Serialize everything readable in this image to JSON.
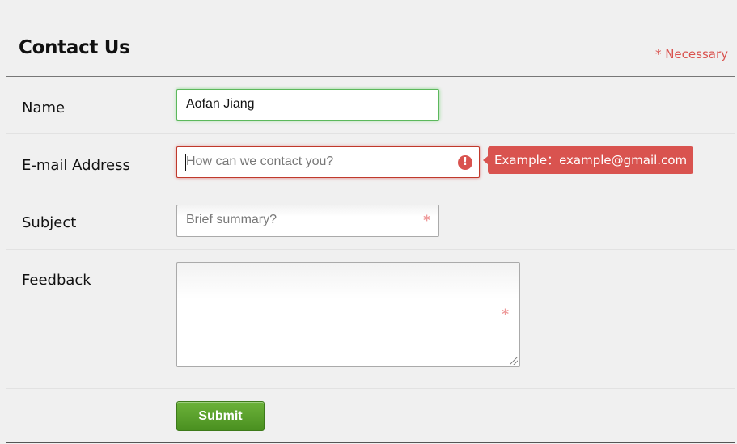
{
  "form": {
    "title": "Contact Us",
    "necessary_note": "* Necessary",
    "submit_label": "Submit"
  },
  "fields": {
    "name": {
      "label": "Name",
      "value": "Aofan Jiang"
    },
    "email": {
      "label": "E-mail Address",
      "placeholder": "How can we contact you?",
      "error_tooltip": "Example：example@gmail.com",
      "error_icon": "!"
    },
    "subject": {
      "label": "Subject",
      "placeholder": "Brief summary?"
    },
    "feedback": {
      "label": "Feedback",
      "value": ""
    }
  },
  "required_marker": "*",
  "colors": {
    "valid": "#5cb85c",
    "invalid": "#d9534f",
    "submit": "#5aa52c",
    "required_star": "#e99999"
  }
}
